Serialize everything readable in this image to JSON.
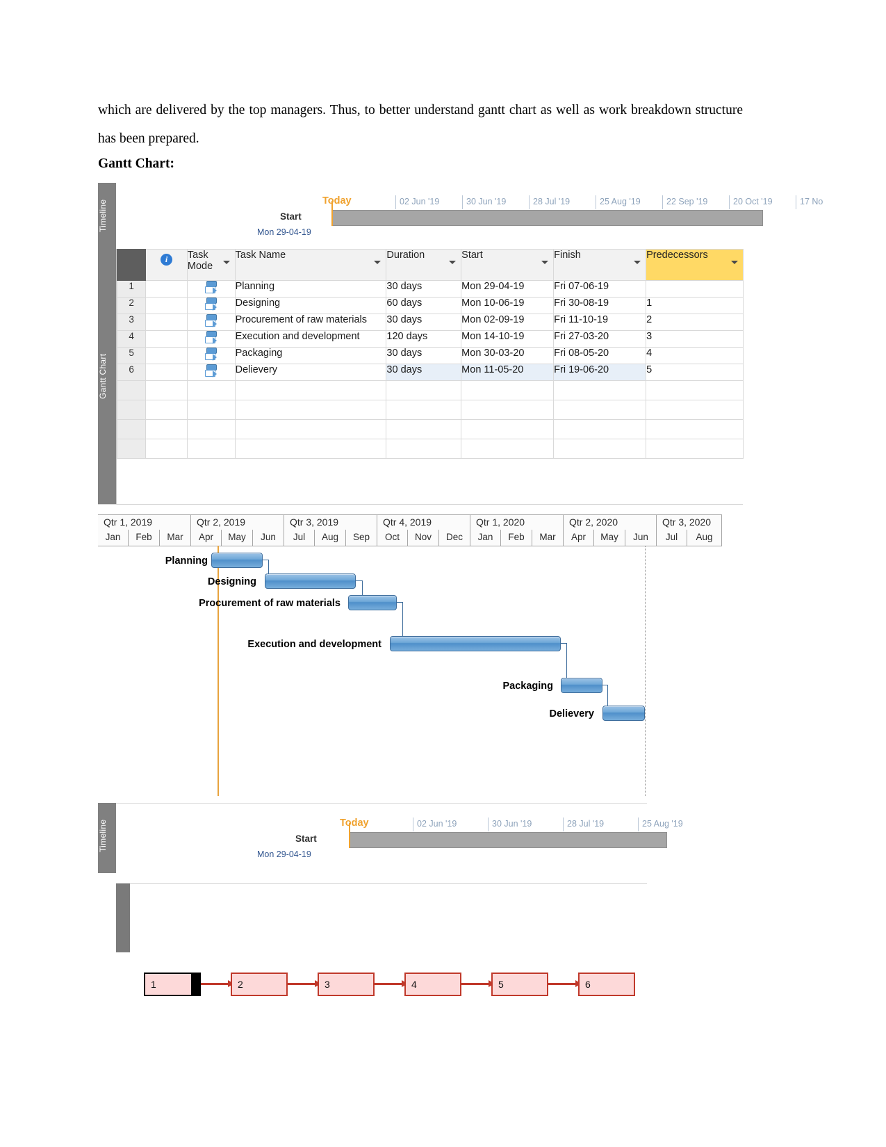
{
  "document": {
    "paragraph": "which are delivered by the top managers. Thus, to better understand gantt chart as well as work breakdown structure has been prepared.",
    "heading": "Gantt Chart:"
  },
  "timeline": {
    "vertical_tab": "Timeline",
    "today_label": "Today",
    "start_label": "Start",
    "start_date": "Mon 29-04-19",
    "ticks": [
      "02 Jun '19",
      "30 Jun '19",
      "28 Jul '19",
      "25 Aug '19",
      "22 Sep '19",
      "20 Oct '19",
      "17 No"
    ]
  },
  "timeline2": {
    "vertical_tab": "Timeline",
    "today_label": "Today",
    "start_label": "Start",
    "start_date": "Mon 29-04-19",
    "ticks": [
      "02 Jun '19",
      "30 Jun '19",
      "28 Jul '19",
      "25 Aug '19"
    ]
  },
  "grid": {
    "vertical_tab": "Gantt Chart",
    "columns": [
      {
        "key": "rownum",
        "label": ""
      },
      {
        "key": "info",
        "label": ""
      },
      {
        "key": "mode",
        "label": "Task Mode"
      },
      {
        "key": "name",
        "label": "Task Name"
      },
      {
        "key": "duration",
        "label": "Duration"
      },
      {
        "key": "start",
        "label": "Start"
      },
      {
        "key": "finish",
        "label": "Finish"
      },
      {
        "key": "predecessors",
        "label": "Predecessors"
      }
    ],
    "rows": [
      {
        "id": "1",
        "name": "Planning",
        "duration": "30 days",
        "start": "Mon 29-04-19",
        "finish": "Fri 07-06-19",
        "predecessors": ""
      },
      {
        "id": "2",
        "name": "Designing",
        "duration": "60 days",
        "start": "Mon 10-06-19",
        "finish": "Fri 30-08-19",
        "predecessors": "1"
      },
      {
        "id": "3",
        "name": "Procurement of raw materials",
        "duration": "30 days",
        "start": "Mon 02-09-19",
        "finish": "Fri 11-10-19",
        "predecessors": "2"
      },
      {
        "id": "4",
        "name": "Execution and development",
        "duration": "120 days",
        "start": "Mon 14-10-19",
        "finish": "Fri 27-03-20",
        "predecessors": "3"
      },
      {
        "id": "5",
        "name": "Packaging",
        "duration": "30 days",
        "start": "Mon 30-03-20",
        "finish": "Fri 08-05-20",
        "predecessors": "4"
      },
      {
        "id": "6",
        "name": "Delievery",
        "duration": "30 days",
        "start": "Mon 11-05-20",
        "finish": "Fri 19-06-20",
        "predecessors": "5"
      }
    ],
    "empty_rows": 4,
    "predecessor_header_color": "#ffd965",
    "selected_row_color": "#e7eff8"
  },
  "chart_data": {
    "type": "bar",
    "title": "Gantt Chart",
    "quarters": [
      "Qtr 1, 2019",
      "Qtr 2, 2019",
      "Qtr 3, 2019",
      "Qtr 4, 2019",
      "Qtr 1, 2020",
      "Qtr 2, 2020",
      "Qtr 3, 2020"
    ],
    "months": [
      "Jan",
      "Feb",
      "Mar",
      "Apr",
      "May",
      "Jun",
      "Jul",
      "Aug",
      "Sep",
      "Oct",
      "Nov",
      "Dec",
      "Jan",
      "Feb",
      "Mar",
      "Apr",
      "May",
      "Jun",
      "Jul",
      "Aug"
    ],
    "xlabel": "",
    "ylabel": "",
    "bar_color": "#5b9bd5",
    "today_marker_color": "#e8a33d",
    "tasks": [
      {
        "name": "Planning",
        "duration_days": 30,
        "start": "Mon 29-04-19",
        "finish": "Fri 07-06-19",
        "predecessor": ""
      },
      {
        "name": "Designing",
        "duration_days": 60,
        "start": "Mon 10-06-19",
        "finish": "Fri 30-08-19",
        "predecessor": "1"
      },
      {
        "name": "Procurement of raw materials",
        "duration_days": 30,
        "start": "Mon 02-09-19",
        "finish": "Fri 11-10-19",
        "predecessor": "2"
      },
      {
        "name": "Execution and development",
        "duration_days": 120,
        "start": "Mon 14-10-19",
        "finish": "Fri 27-03-20",
        "predecessor": "3"
      },
      {
        "name": "Packaging",
        "duration_days": 30,
        "start": "Mon 30-03-20",
        "finish": "Fri 08-05-20",
        "predecessor": "4"
      },
      {
        "name": "Delievery",
        "duration_days": 30,
        "start": "Mon 11-05-20",
        "finish": "Fri 19-06-20",
        "predecessor": "5"
      }
    ]
  },
  "network": {
    "nodes": [
      "1",
      "2",
      "3",
      "4",
      "5",
      "6"
    ],
    "box_fill": "#fdd9d9",
    "box_border": "#c0392b"
  }
}
